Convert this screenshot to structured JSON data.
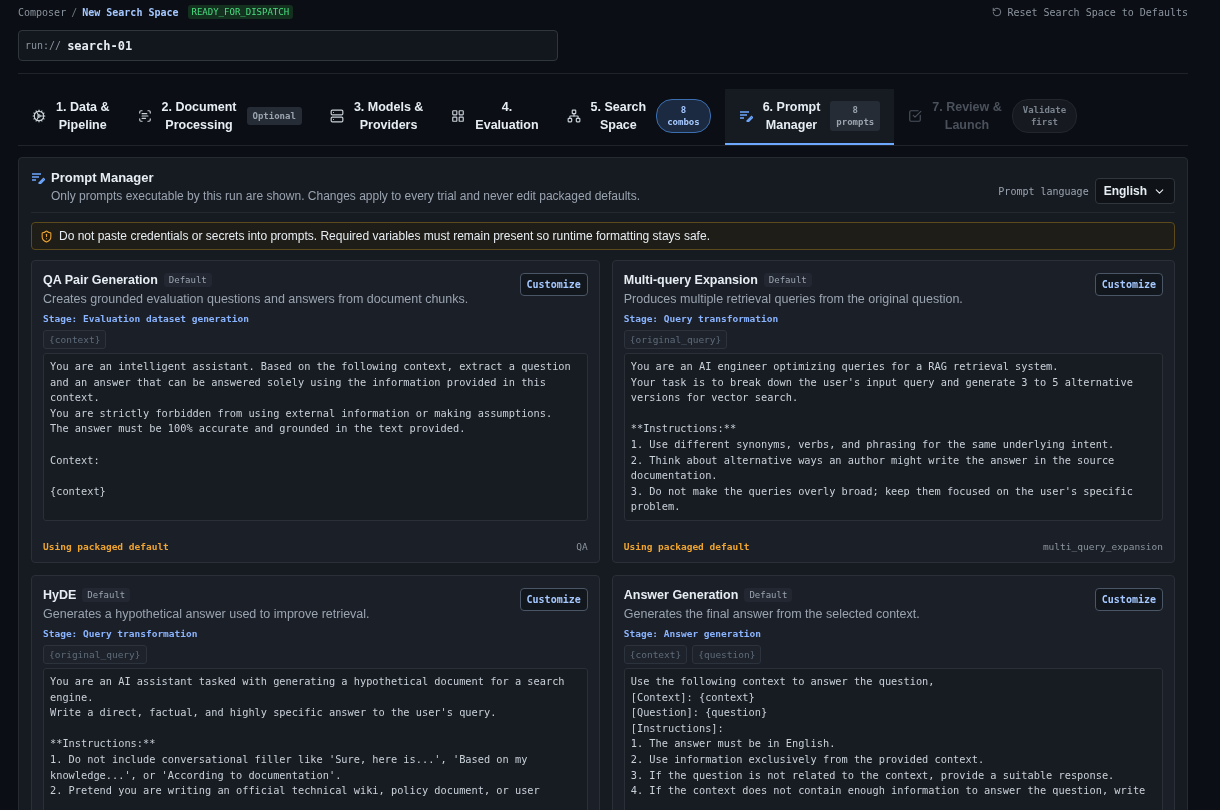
{
  "breadcrumb": {
    "root": "Composer",
    "separator": "/",
    "current": "New Search Space",
    "status": "READY_FOR_DISPATCH"
  },
  "reset_button": "Reset Search Space to Defaults",
  "run_field": {
    "prefix": "run://",
    "value": "search-01"
  },
  "tabs": [
    {
      "label": [
        "1. Data &",
        "Pipeline"
      ],
      "selected": false,
      "disabled": false
    },
    {
      "label": [
        "2. Document",
        "Processing"
      ],
      "badge": {
        "kind": "tag",
        "text": [
          "Optional"
        ]
      },
      "selected": false,
      "disabled": false
    },
    {
      "label": [
        "3. Models &",
        "Providers"
      ],
      "selected": false,
      "disabled": false
    },
    {
      "label": [
        "4.",
        "Evaluation"
      ],
      "selected": false,
      "disabled": false
    },
    {
      "label": [
        "5. Search",
        "Space"
      ],
      "badge": {
        "kind": "pill",
        "text": [
          "8",
          "combos"
        ]
      },
      "selected": false,
      "disabled": false
    },
    {
      "label": [
        "6. Prompt",
        "Manager"
      ],
      "badge": {
        "kind": "tag",
        "text": [
          "8",
          "prompts"
        ]
      },
      "selected": true,
      "disabled": false
    },
    {
      "label": [
        "7. Review &",
        "Launch"
      ],
      "badge": {
        "kind": "pill",
        "text": [
          "Validate",
          "first"
        ]
      },
      "selected": false,
      "disabled": true
    }
  ],
  "panel": {
    "title": "Prompt Manager",
    "subtitle": "Only prompts executable by this run are shown. Changes apply to every trial and never edit packaged defaults.",
    "language": {
      "label": "Prompt language",
      "value": "English"
    },
    "warning": "Do not paste credentials or secrets into prompts. Required variables must remain present so runtime formatting stays safe.",
    "cards": [
      {
        "title": "QA Pair Generation",
        "badge": "Default",
        "action": "Customize",
        "description": "Creates grounded evaluation questions and answers from document chunks.",
        "stage": "Stage: Evaluation dataset generation",
        "variables": [
          "{context}"
        ],
        "prompt": "You are an intelligent assistant. Based on the following context, extract a question\nand an answer that can be answered solely using the information provided in this\ncontext.\nYou are strictly forbidden from using external information or making assumptions.\nThe answer must be 100% accurate and grounded in the text provided.\n\nContext:\n\n{context}",
        "status": "Using packaged default",
        "key": "QA"
      },
      {
        "title": "Multi-query Expansion",
        "badge": "Default",
        "action": "Customize",
        "description": "Produces multiple retrieval queries from the original question.",
        "stage": "Stage: Query transformation",
        "variables": [
          "{original_query}"
        ],
        "prompt": "You are an AI engineer optimizing queries for a RAG retrieval system.\nYour task is to break down the user's input query and generate 3 to 5 alternative\nversions for vector search.\n\n**Instructions:**\n1. Use different synonyms, verbs, and phrasing for the same underlying intent.\n2. Think about alternative ways an author might write the answer in the source\ndocumentation.\n3. Do not make the queries overly broad; keep them focused on the user's specific\nproblem.",
        "status": "Using packaged default",
        "key": "multi_query_expansion"
      },
      {
        "title": "HyDE",
        "badge": "Default",
        "action": "Customize",
        "description": "Generates a hypothetical answer used to improve retrieval.",
        "stage": "Stage: Query transformation",
        "variables": [
          "{original_query}"
        ],
        "prompt": "You are an AI assistant tasked with generating a hypothetical document for a search\nengine.\nWrite a direct, factual, and highly specific answer to the user's query.\n\n**Instructions:**\n1. Do not include conversational filler like 'Sure, here is...', 'Based on my\nknowledge...', or 'According to documentation'.\n2. Pretend you are writing an official technical wiki, policy document, or user"
      },
      {
        "title": "Answer Generation",
        "badge": "Default",
        "action": "Customize",
        "description": "Generates the final answer from the selected context.",
        "stage": "Stage: Answer generation",
        "variables": [
          "{context}",
          "{question}"
        ],
        "prompt": "Use the following context to answer the question,\n[Context]: {context}\n[Question]: {question}\n[Instructions]:\n1. The answer must be in English.\n2. Use information exclusively from the provided context.\n3. If the question is not related to the context, provide a suitable response.\n4. If the context does not contain enough information to answer the question, write"
      }
    ]
  }
}
